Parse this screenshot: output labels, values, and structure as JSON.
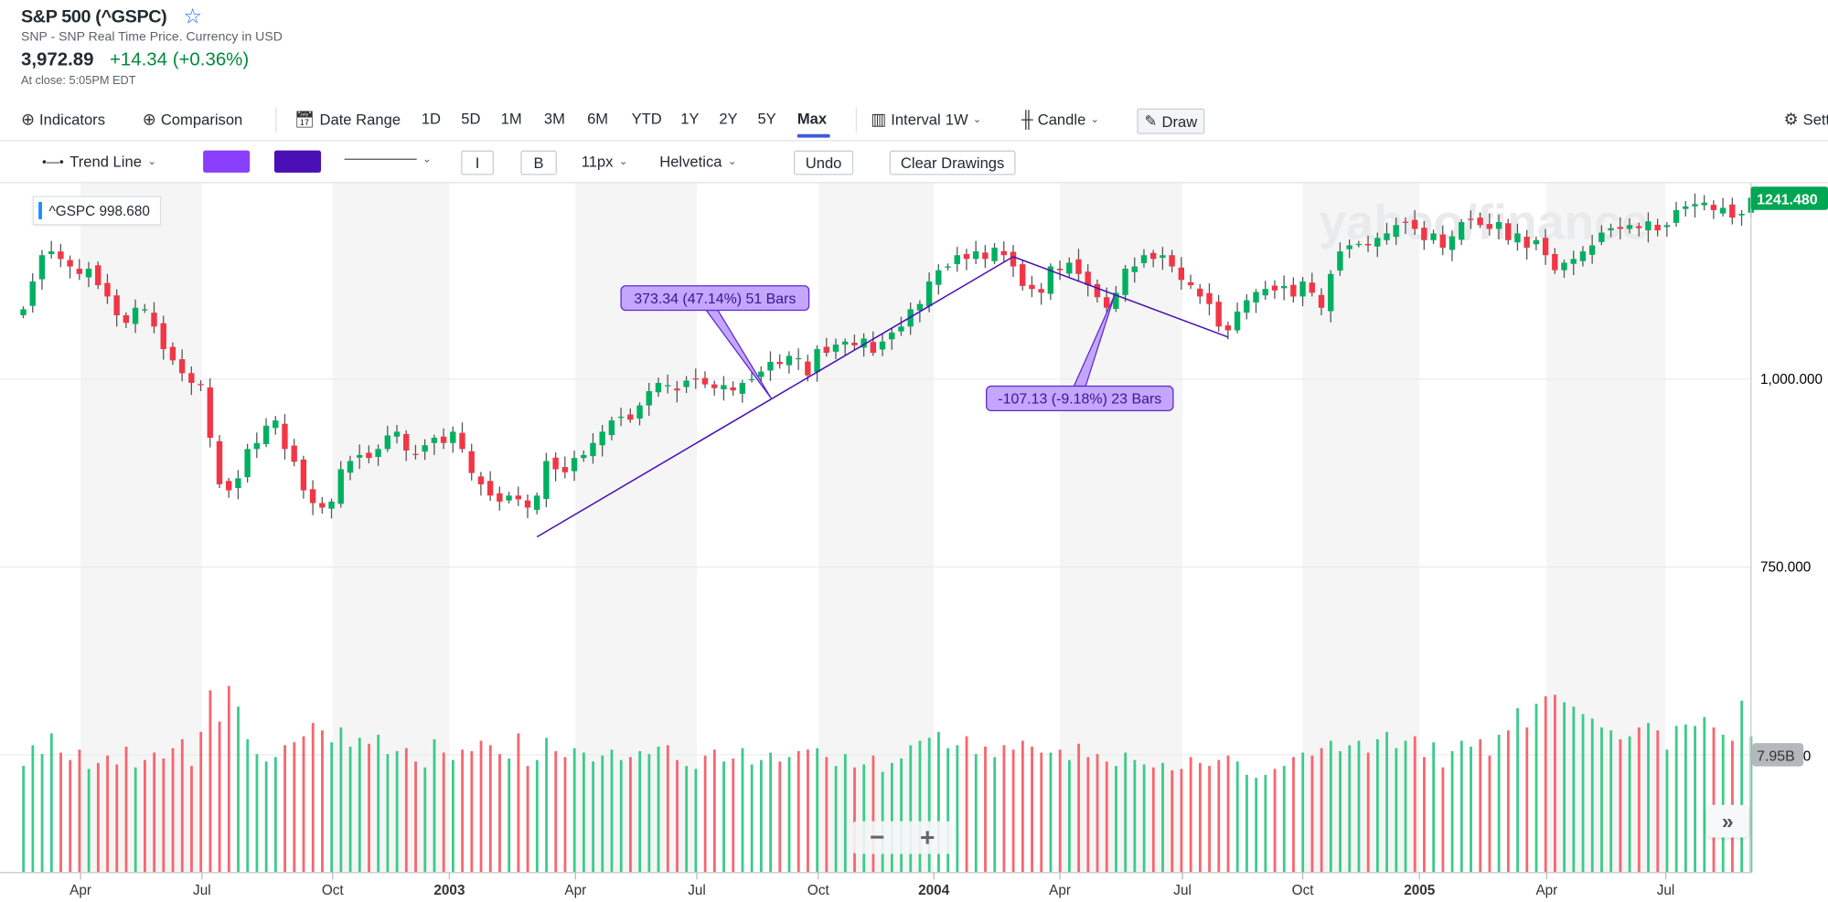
{
  "header": {
    "title": "S&P 500 (^GSPC)",
    "subtitle": "SNP - SNP Real Time Price. Currency in USD",
    "price": "3,972.89",
    "change": "+14.34 (+0.36%)",
    "close_time": "At close: 5:05PM EDT",
    "watchlist_icon": "star-outline-icon"
  },
  "toolbar": {
    "indicators": "Indicators",
    "comparison": "Comparison",
    "date_range": "Date Range",
    "ranges": [
      "1D",
      "5D",
      "1M",
      "3M",
      "6M",
      "YTD",
      "1Y",
      "2Y",
      "5Y",
      "Max"
    ],
    "active_range": "Max",
    "interval_label": "Interval",
    "interval_value": "1W",
    "chart_type": "Candle",
    "draw": "Draw",
    "settings": "Settings",
    "accent": "#3e5bd7"
  },
  "draw_toolbar": {
    "tool": "Trend Line",
    "fill_color": "#8a3ffc",
    "line_color": "#4a0fb5",
    "bold_label": "B",
    "italic_label": "I",
    "font_size": "11px",
    "font": "Helvetica",
    "undo": "Undo",
    "clear": "Clear Drawings"
  },
  "legend": {
    "symbol": "^GSPC",
    "value": "998.680"
  },
  "watermark": "yahoo/finance",
  "zoom_controls": {
    "minus": "−",
    "plus": "+"
  },
  "scroll_button": "»",
  "chart_data": {
    "type": "candlestick",
    "interval": "weekly",
    "price_axis": {
      "ticks": [
        "1,000.000",
        "750.000"
      ],
      "tick_values": [
        1000,
        750
      ],
      "last_price_label": "1241.480",
      "last_price": 1241.48
    },
    "volume_axis": {
      "label": "7.95B",
      "value": 7.95,
      "unit": "B"
    },
    "x_ticks": [
      {
        "label": "Apr",
        "bold": false
      },
      {
        "label": "Jul",
        "bold": false
      },
      {
        "label": "Oct",
        "bold": false
      },
      {
        "label": "2003",
        "bold": true
      },
      {
        "label": "Apr",
        "bold": false
      },
      {
        "label": "Jul",
        "bold": false
      },
      {
        "label": "Oct",
        "bold": false
      },
      {
        "label": "2004",
        "bold": true
      },
      {
        "label": "Apr",
        "bold": false
      },
      {
        "label": "Jul",
        "bold": false
      },
      {
        "label": "Oct",
        "bold": false
      },
      {
        "label": "2005",
        "bold": true
      },
      {
        "label": "Apr",
        "bold": false
      },
      {
        "label": "Jul",
        "bold": false
      }
    ],
    "colors": {
      "up": "#00b061",
      "down": "#f23645",
      "volume_up": "#3ccb8a",
      "volume_down": "#f7666f"
    },
    "close": [
      1093,
      1130,
      1165,
      1170,
      1160,
      1150,
      1140,
      1147,
      1125,
      1110,
      1085,
      1075,
      1095,
      1093,
      1070,
      1040,
      1025,
      1008,
      995,
      992,
      922,
      860,
      852,
      868,
      907,
      915,
      938,
      945,
      907,
      890,
      852,
      835,
      829,
      837,
      880,
      891,
      899,
      895,
      907,
      925,
      930,
      905,
      899,
      912,
      922,
      915,
      930,
      907,
      875,
      860,
      845,
      837,
      845,
      840,
      829,
      845,
      891,
      880,
      876,
      895,
      899,
      915,
      930,
      945,
      950,
      946,
      965,
      984,
      995,
      992,
      985,
      998,
      1000,
      993,
      988,
      992,
      985,
      995,
      1000,
      1010,
      1023,
      1020,
      1031,
      1028,
      1005,
      1040,
      1035,
      1046,
      1050,
      1045,
      1054,
      1035,
      1050,
      1062,
      1070,
      1093,
      1100,
      1130,
      1145,
      1150,
      1165,
      1160,
      1170,
      1160,
      1175,
      1165,
      1150,
      1124,
      1120,
      1115,
      1150,
      1145,
      1155,
      1140,
      1125,
      1109,
      1095,
      1115,
      1147,
      1150,
      1165,
      1160,
      1165,
      1150,
      1132,
      1125,
      1110,
      1100,
      1070,
      1065,
      1090,
      1105,
      1116,
      1120,
      1118,
      1124,
      1110,
      1130,
      1115,
      1095,
      1140,
      1170,
      1178,
      1180,
      1178,
      1188,
      1194,
      1205,
      1209,
      1200,
      1185,
      1194,
      1175,
      1190,
      1209,
      1212,
      1205,
      1200,
      1209,
      1185,
      1194,
      1175,
      1185,
      1165,
      1145,
      1155,
      1160,
      1170,
      1178,
      1195,
      1201,
      1200,
      1205,
      1201,
      1210,
      1198,
      1205,
      1225,
      1230,
      1233,
      1235,
      1225,
      1228,
      1215,
      1220,
      1241.48
    ],
    "volume_billions": [
      7.2,
      8.6,
      8.0,
      9.4,
      8.1,
      7.6,
      8.3,
      7.0,
      7.4,
      7.9,
      7.3,
      8.5,
      7.1,
      7.6,
      8.1,
      7.7,
      8.4,
      9.0,
      7.2,
      9.5,
      12.3,
      10.2,
      12.6,
      11.2,
      9.0,
      8.0,
      7.5,
      7.8,
      8.6,
      8.8,
      9.2,
      10.1,
      9.6,
      8.8,
      9.8,
      8.5,
      9.1,
      8.7,
      9.3,
      8.0,
      8.2,
      8.4,
      7.5,
      7.1,
      9.0,
      8.1,
      7.6,
      8.3,
      8.2,
      8.9,
      8.6,
      8.0,
      7.7,
      9.4,
      7.2,
      7.6,
      9.1,
      8.2,
      7.8,
      8.4,
      8.1,
      7.5,
      7.9,
      8.3,
      7.6,
      7.8,
      8.2,
      8.0,
      8.5,
      8.6,
      7.6,
      7.2,
      7.0,
      7.9,
      8.3,
      7.5,
      7.7,
      8.4,
      7.3,
      7.6,
      8.1,
      7.5,
      7.8,
      8.2,
      8.3,
      8.4,
      7.8,
      7.2,
      8.0,
      7.1,
      7.3,
      7.9,
      6.8,
      7.4,
      7.7,
      8.6,
      8.9,
      9.1,
      9.5,
      8.4,
      8.6,
      9.2,
      8.0,
      8.5,
      7.8,
      8.6,
      8.3,
      8.9,
      8.5,
      8.1,
      8.1,
      8.3,
      7.6,
      8.7,
      7.8,
      8.0,
      7.5,
      7.2,
      8.1,
      7.6,
      7.3,
      7.1,
      7.4,
      6.9,
      7.0,
      7.8,
      7.4,
      7.2,
      7.6,
      7.9,
      7.5,
      6.6,
      6.4,
      6.6,
      7.0,
      7.2,
      7.8,
      8.1,
      7.9,
      8.4,
      8.9,
      8.2,
      8.6,
      8.9,
      8.1,
      9.0,
      9.5,
      8.4,
      8.9,
      9.2,
      7.8,
      8.8,
      7.1,
      8.2,
      8.9,
      8.5,
      9.0,
      7.9,
      9.3,
      9.6,
      11.1,
      9.8,
      11.4,
      11.9,
      12.0,
      11.5,
      11.2,
      10.7,
      10.4,
      9.8,
      9.6,
      9.0,
      9.2,
      9.8,
      10.1,
      9.6,
      8.3,
      9.9,
      10.0,
      9.9,
      10.5,
      9.8,
      9.3,
      8.9,
      11.6,
      9.2
    ],
    "annotations": [
      {
        "type": "trend_line",
        "from_bar": 55,
        "to_bar": 106,
        "from_price": 790,
        "to_price": 1163,
        "label": "373.34 (47.14%) 51 Bars"
      },
      {
        "type": "trend_line",
        "from_bar": 106,
        "to_bar": 129,
        "from_price": 1163,
        "to_price": 1056,
        "label": "-107.13 (-9.18%) 23 Bars"
      }
    ]
  }
}
